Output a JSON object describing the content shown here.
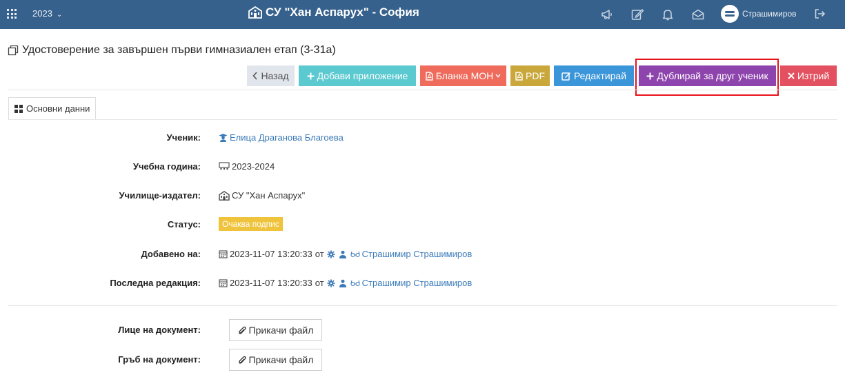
{
  "topbar": {
    "year": "2023",
    "school_title": "СУ \"Хан Аспарух\" - София",
    "user_name": "Страшимиров"
  },
  "page": {
    "title": "Удостоверение за завършен първи гимназиален етап (3-31а)"
  },
  "actions": {
    "back": "Назад",
    "add_attachment": "Добави приложение",
    "mon_form": "Бланка МОН",
    "pdf": "PDF",
    "edit": "Редактирай",
    "duplicate": "Дублирай за друг ученик",
    "delete": "Изтрий"
  },
  "tabs": {
    "main": "Основни данни"
  },
  "details": {
    "student_label": "Ученик:",
    "student_value": "Елица Драганова Благоева",
    "year_label": "Учебна година:",
    "year_value": "2023-2024",
    "school_label": "Училище-издател:",
    "school_value": "СУ \"Хан Аспарух\"",
    "status_label": "Статус:",
    "status_value": "Очаква подпис",
    "added_label": "Добавено на:",
    "added_date": "2023-11-07 13:20:33",
    "added_by_prefix": "от",
    "added_by": "Страшимир Страшимиров",
    "edited_label": "Последна редакция:",
    "edited_date": "2023-11-07 13:20:33",
    "edited_by_prefix": "от",
    "edited_by": "Страшимир Страшимиров"
  },
  "attachments": {
    "front_label": "Лице на документ:",
    "back_label": "Гръб на документ:",
    "attach_file": "Прикачи файл"
  },
  "colors": {
    "topbar": "#36618c",
    "duplicate_button": "#8e44ad",
    "highlight": "#e8121b",
    "status_badge": "#f0c33c"
  }
}
